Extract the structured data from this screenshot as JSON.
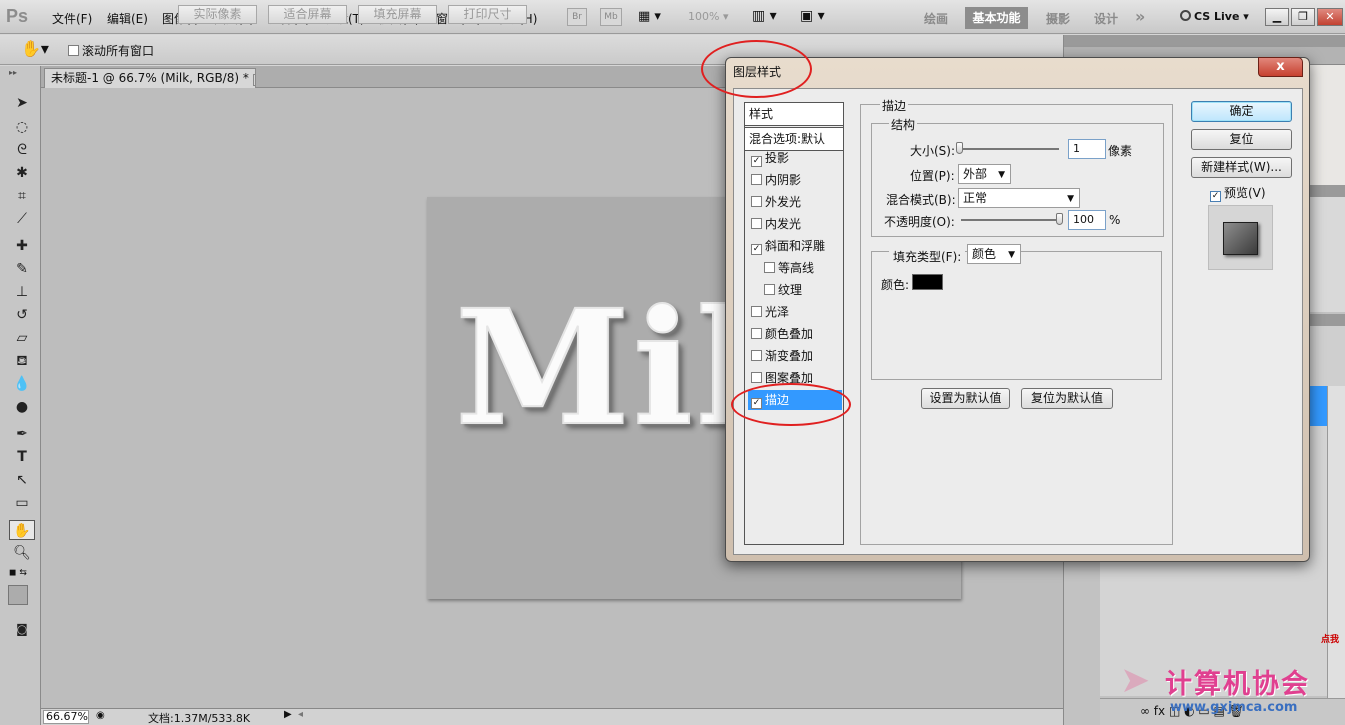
{
  "app": {
    "logo": "Ps",
    "title_tab": "未标题-1 @ 66.7% (Milk, RGB/8) *"
  },
  "menu": [
    "文件(F)",
    "编辑(E)",
    "图像(I)",
    "图层(L)",
    "选择(S)",
    "滤镜(T)",
    "视图(V)",
    "窗口(W)",
    "帮助(H)"
  ],
  "topbar": {
    "br": "Br",
    "mb": "Mb",
    "zoom": "100%",
    "workspaces": [
      "绘画",
      "基本功能",
      "摄影",
      "设计"
    ],
    "more": "»",
    "cslive": "CS Live"
  },
  "options": {
    "scroll_all": "滚动所有窗口",
    "buttons": [
      "实际像素",
      "适合屏幕",
      "填充屏幕",
      "打印尺寸"
    ]
  },
  "canvas": {
    "text": "Milk"
  },
  "status": {
    "zoom": "66.67%",
    "doc": "文档:1.37M/533.8K"
  },
  "dialog": {
    "title": "图层样式",
    "close": "x",
    "list_header": "样式",
    "blend_default": "混合选项:默认",
    "items": [
      {
        "label": "投影",
        "checked": true,
        "indent": false
      },
      {
        "label": "内阴影",
        "checked": false,
        "indent": false
      },
      {
        "label": "外发光",
        "checked": false,
        "indent": false
      },
      {
        "label": "内发光",
        "checked": false,
        "indent": false
      },
      {
        "label": "斜面和浮雕",
        "checked": true,
        "indent": false
      },
      {
        "label": "等高线",
        "checked": false,
        "indent": true
      },
      {
        "label": "纹理",
        "checked": false,
        "indent": true
      },
      {
        "label": "光泽",
        "checked": false,
        "indent": false
      },
      {
        "label": "颜色叠加",
        "checked": false,
        "indent": false
      },
      {
        "label": "渐变叠加",
        "checked": false,
        "indent": false
      },
      {
        "label": "图案叠加",
        "checked": false,
        "indent": false
      },
      {
        "label": "描边",
        "checked": true,
        "indent": false,
        "selected": true
      }
    ],
    "stroke": {
      "section": "描边",
      "structure": "结构",
      "size_label": "大小(S):",
      "size_value": "1",
      "size_unit": "像素",
      "position_label": "位置(P):",
      "position_value": "外部",
      "blend_label": "混合模式(B):",
      "blend_value": "正常",
      "opacity_label": "不透明度(O):",
      "opacity_value": "100",
      "opacity_unit": "%",
      "size_slider": 0.0,
      "opacity_slider": 1.0,
      "fill_type_label": "填充类型(F):",
      "fill_type_value": "颜色",
      "color_label": "颜色:",
      "color": "#000000",
      "set_default": "设置为默认值",
      "reset_default": "复位为默认值"
    },
    "buttons": {
      "ok": "确定",
      "reset": "复位",
      "new_style": "新建样式(W)...",
      "preview": "预览(V)"
    },
    "preview_checked": true
  },
  "watermark": {
    "text": "计算机协会",
    "url": "www.gxjmca.com",
    "tag": "点我"
  },
  "colors": {
    "highlight": "#3399ff",
    "annotation": "#e02020"
  }
}
